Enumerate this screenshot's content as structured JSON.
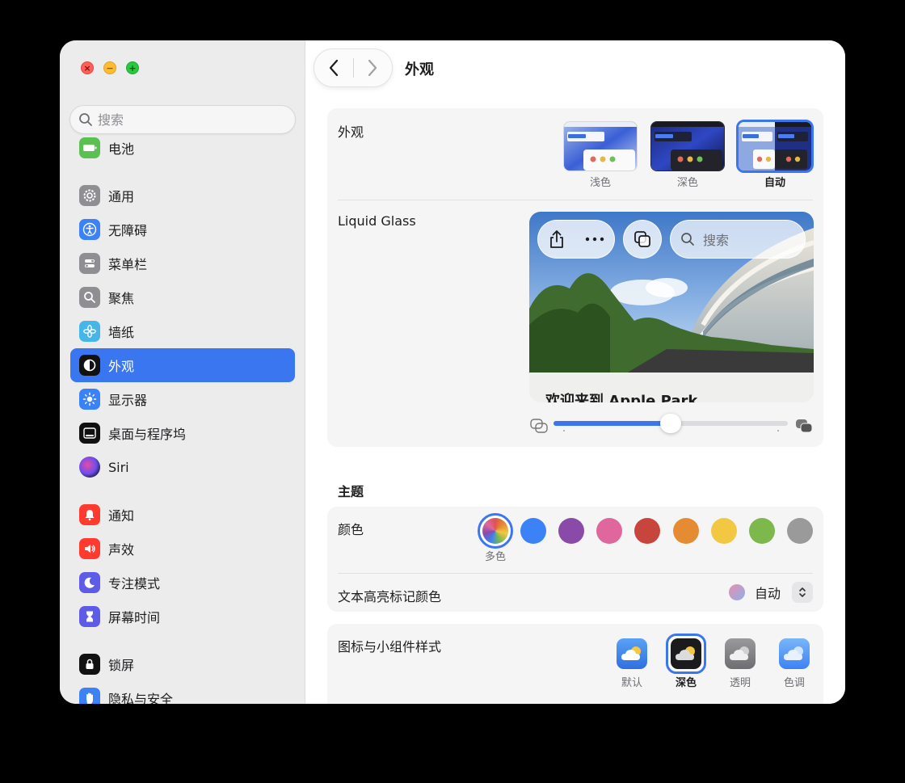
{
  "window": {
    "title": "外观"
  },
  "sidebar": {
    "search_placeholder": "搜索",
    "items": [
      {
        "label": "电池",
        "icon": "battery-icon",
        "color": "#5bc052"
      },
      {
        "label": "通用",
        "icon": "gear-icon",
        "color": "#8e8e93"
      },
      {
        "label": "无障碍",
        "icon": "accessibility-icon",
        "color": "#3b82f6"
      },
      {
        "label": "菜单栏",
        "icon": "menubar-icon",
        "color": "#8e8e93"
      },
      {
        "label": "聚焦",
        "icon": "magnifier-icon",
        "color": "#8e8e93"
      },
      {
        "label": "墙纸",
        "icon": "flower-icon",
        "color": "#46b5e8"
      },
      {
        "label": "外观",
        "icon": "appearance-icon",
        "color": "#111111"
      },
      {
        "label": "显示器",
        "icon": "sun-icon",
        "color": "#3b82f6"
      },
      {
        "label": "桌面与程序坞",
        "icon": "dock-icon",
        "color": "#111111"
      },
      {
        "label": "Siri",
        "icon": "siri-icon",
        "color": "#1b1b3a"
      },
      {
        "label": "通知",
        "icon": "bell-icon",
        "color": "#ff3b30"
      },
      {
        "label": "声效",
        "icon": "speaker-icon",
        "color": "#ff3b30"
      },
      {
        "label": "专注模式",
        "icon": "moon-icon",
        "color": "#5e5ce6"
      },
      {
        "label": "屏幕时间",
        "icon": "hourglass-icon",
        "color": "#5e5ce6"
      },
      {
        "label": "锁屏",
        "icon": "lock-icon",
        "color": "#111111"
      },
      {
        "label": "隐私与安全",
        "icon": "hand-icon",
        "color": "#3b82f6"
      }
    ]
  },
  "appearance": {
    "label": "外观",
    "options": [
      {
        "label": "浅色"
      },
      {
        "label": "深色"
      },
      {
        "label": "自动"
      }
    ],
    "selected": "自动"
  },
  "liquid_glass": {
    "label": "Liquid Glass",
    "preview_search": "搜索",
    "preview_caption": "欢迎来到 Apple Park",
    "slider_value": 0.5
  },
  "theme": {
    "heading": "主题",
    "color_label": "颜色",
    "selected_color_label": "多色",
    "colors": [
      "multicolor",
      "#3b82f6",
      "#8a4ba8",
      "#e0679e",
      "#c7453c",
      "#e58c32",
      "#f2c843",
      "#7db84c",
      "#9a9a9a"
    ],
    "highlight_label": "文本高亮标记颜色",
    "highlight_value": "自动"
  },
  "icons": {
    "label": "图标与小组件样式",
    "options": [
      {
        "label": "默认"
      },
      {
        "label": "深色"
      },
      {
        "label": "透明"
      },
      {
        "label": "色调"
      }
    ],
    "selected": "深色"
  }
}
